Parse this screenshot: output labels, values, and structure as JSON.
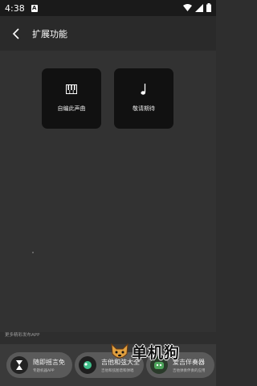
{
  "status_bar": {
    "time": "4:38",
    "notification_letter": "A"
  },
  "header": {
    "title": "扩展功能"
  },
  "features": [
    {
      "label": "自编此声曲",
      "icon": "piano-icon"
    },
    {
      "label": "敬请期待",
      "icon": "music-note-icon"
    }
  ],
  "footer": {
    "note": "更多精彩发布APP"
  },
  "ads": [
    {
      "title": "随即摇言免",
      "subtitle": "专题机器APP",
      "icon": "hourglass-icon"
    },
    {
      "title": "吉他和弦大全",
      "subtitle": "吉他和弦图谱和弹唱",
      "icon": "guitar-chord-icon"
    },
    {
      "title": "爱吉伴奏器",
      "subtitle": "吉他弹奏伴奏的应用",
      "icon": "robot-icon"
    }
  ],
  "watermark": {
    "text": "单机狗"
  },
  "colors": {
    "background": "#323232",
    "card": "#111111",
    "app_bar": "#2a2a2a"
  }
}
